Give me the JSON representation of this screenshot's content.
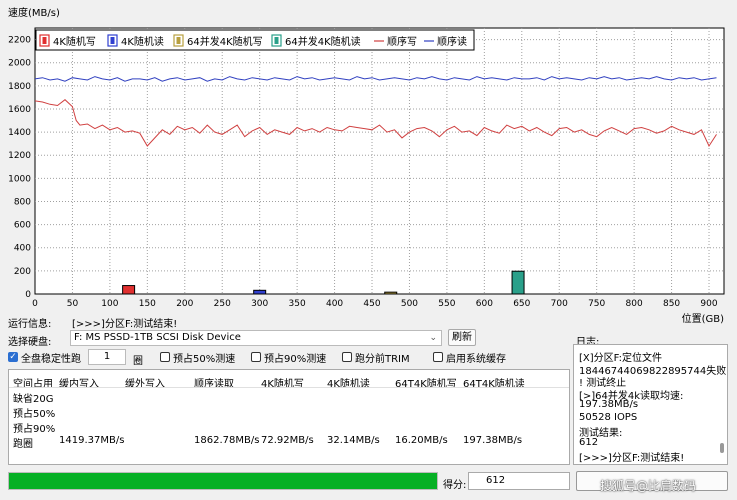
{
  "chart_data": {
    "type": "line",
    "ylabel": "速度(MB/s)",
    "xlabel": "位置(GB)",
    "ylim": [
      0,
      2300
    ],
    "xlim": [
      0,
      920
    ],
    "y_ticks": [
      0,
      200,
      400,
      600,
      800,
      1000,
      1200,
      1400,
      1600,
      1800,
      2000,
      2200
    ],
    "x_ticks": [
      0,
      50,
      100,
      150,
      200,
      250,
      300,
      350,
      400,
      450,
      500,
      550,
      600,
      650,
      700,
      750,
      800,
      850,
      900
    ],
    "grid": true,
    "legend_position": "top-left",
    "legend": [
      "4K随机写",
      "4K随机读",
      "64并发4K随机写",
      "64并发4K随机读",
      "顺序写",
      "顺序读"
    ],
    "bars": [
      {
        "name": "4K随机写",
        "x": 125,
        "value": 73,
        "color": "#e03030"
      },
      {
        "name": "4K随机读",
        "x": 300,
        "value": 32,
        "color": "#3040d0"
      },
      {
        "name": "64并发4K随机写",
        "x": 475,
        "value": 16,
        "color": "#b8a040"
      },
      {
        "name": "64并发4K随机读",
        "x": 645,
        "value": 197,
        "color": "#2aa08a"
      }
    ],
    "series": [
      {
        "name": "顺序写",
        "color": "#d04040",
        "x": [
          0,
          10,
          20,
          30,
          40,
          50,
          55,
          60,
          70,
          80,
          90,
          100,
          110,
          120,
          130,
          140,
          150,
          160,
          170,
          180,
          190,
          200,
          210,
          220,
          230,
          240,
          250,
          260,
          270,
          280,
          290,
          300,
          310,
          320,
          330,
          340,
          350,
          360,
          370,
          380,
          390,
          400,
          410,
          420,
          430,
          440,
          450,
          460,
          470,
          480,
          490,
          500,
          510,
          520,
          530,
          540,
          550,
          560,
          570,
          580,
          590,
          600,
          610,
          620,
          630,
          640,
          650,
          660,
          670,
          680,
          690,
          700,
          710,
          720,
          730,
          740,
          750,
          760,
          770,
          780,
          790,
          800,
          810,
          820,
          830,
          840,
          850,
          860,
          870,
          880,
          890,
          900,
          910
        ],
        "y": [
          1670,
          1660,
          1640,
          1630,
          1680,
          1620,
          1500,
          1460,
          1470,
          1430,
          1460,
          1420,
          1440,
          1400,
          1410,
          1390,
          1280,
          1350,
          1420,
          1380,
          1450,
          1420,
          1440,
          1390,
          1460,
          1400,
          1380,
          1420,
          1460,
          1360,
          1410,
          1440,
          1380,
          1420,
          1400,
          1380,
          1440,
          1410,
          1430,
          1400,
          1440,
          1420,
          1410,
          1450,
          1440,
          1430,
          1420,
          1460,
          1400,
          1420,
          1350,
          1400,
          1430,
          1440,
          1410,
          1360,
          1420,
          1450,
          1400,
          1410,
          1370,
          1440,
          1410,
          1390,
          1460,
          1430,
          1450,
          1410,
          1440,
          1400,
          1370,
          1430,
          1440,
          1400,
          1420,
          1380,
          1360,
          1410,
          1440,
          1410,
          1380,
          1430,
          1440,
          1420,
          1390,
          1410,
          1450,
          1420,
          1400,
          1380,
          1420,
          1280,
          1380
        ]
      },
      {
        "name": "顺序读",
        "color": "#3040c0",
        "x": [
          0,
          10,
          20,
          30,
          40,
          50,
          60,
          70,
          80,
          90,
          100,
          110,
          120,
          130,
          140,
          150,
          160,
          170,
          180,
          190,
          200,
          210,
          220,
          230,
          240,
          250,
          260,
          270,
          280,
          290,
          300,
          310,
          320,
          330,
          340,
          350,
          360,
          370,
          380,
          390,
          400,
          410,
          420,
          430,
          440,
          450,
          460,
          470,
          480,
          490,
          500,
          510,
          520,
          530,
          540,
          550,
          560,
          570,
          580,
          590,
          600,
          610,
          620,
          630,
          640,
          650,
          660,
          670,
          680,
          690,
          700,
          710,
          720,
          730,
          740,
          750,
          760,
          770,
          780,
          790,
          800,
          810,
          820,
          830,
          840,
          850,
          860,
          870,
          880,
          890,
          900,
          910
        ],
        "y": [
          1860,
          1870,
          1850,
          1860,
          1840,
          1870,
          1860,
          1850,
          1880,
          1860,
          1850,
          1870,
          1840,
          1860,
          1860,
          1850,
          1870,
          1840,
          1860,
          1870,
          1850,
          1860,
          1870,
          1840,
          1860,
          1850,
          1880,
          1860,
          1850,
          1870,
          1860,
          1850,
          1870,
          1860,
          1850,
          1880,
          1860,
          1870,
          1850,
          1860,
          1870,
          1860,
          1850,
          1880,
          1860,
          1870,
          1850,
          1860,
          1870,
          1860,
          1850,
          1870,
          1860,
          1880,
          1860,
          1850,
          1870,
          1860,
          1850,
          1880,
          1860,
          1870,
          1860,
          1850,
          1870,
          1860,
          1860,
          1870,
          1850,
          1880,
          1860,
          1870,
          1860,
          1850,
          1870,
          1860,
          1880,
          1860,
          1870,
          1850,
          1860,
          1870,
          1860,
          1880,
          1860,
          1850,
          1870,
          1860,
          1870,
          1850,
          1860,
          1870
        ]
      }
    ]
  },
  "info_label": "运行信息:",
  "info_text": "[>>>]分区F:测试结束!",
  "disk_label": "选择硬盘:",
  "disk_value": "F: MS PSSD-1TB SCSI Disk Device",
  "refresh_label": "刷新",
  "log_label": "日志:",
  "options": {
    "full_disk": {
      "label": "全盘稳定性跑",
      "checked": true
    },
    "loops_value": "1",
    "loops_unit": "圈",
    "pre50": {
      "label": "预占50%测速",
      "checked": false
    },
    "pre90": {
      "label": "预占90%测速",
      "checked": false
    },
    "trim": {
      "label": "跑分前TRIM",
      "checked": false
    },
    "cache": {
      "label": "启用系统缓存",
      "checked": false
    }
  },
  "results": {
    "headers": [
      "空间占用",
      "缓内写入",
      "缓外写入",
      "顺序读取",
      "4K随机写",
      "4K随机读",
      "64T4K随机写",
      "64T4K随机读"
    ],
    "rows": [
      [
        "缺省20G",
        "",
        "",
        "",
        "",
        "",
        "",
        ""
      ],
      [
        "预占50%",
        "",
        "",
        "",
        "",
        "",
        "",
        ""
      ],
      [
        "预占90%",
        "",
        "",
        "",
        "",
        "",
        "",
        ""
      ],
      [
        "跑圈",
        "1419.37MB/s",
        "",
        "1862.78MB/s",
        "72.92MB/s",
        "32.14MB/s",
        "16.20MB/s",
        "197.38MB/s"
      ]
    ]
  },
  "log": [
    "[X]分区F:定位文件",
    "18446744069822895744失败",
    "! 测试终止",
    "[>]64并发4k读取均速:",
    "197.38MB/s",
    "50528 IOPS",
    "测试结果:",
    "612",
    "[>>>]分区F:测试结束!"
  ],
  "progress_pct": 100,
  "score_label": "得分:",
  "score_value": "612",
  "watermark": "搜狐号@比肩数码",
  "colors": {
    "progress": "#06b025",
    "accent": "#2b6fd1"
  }
}
